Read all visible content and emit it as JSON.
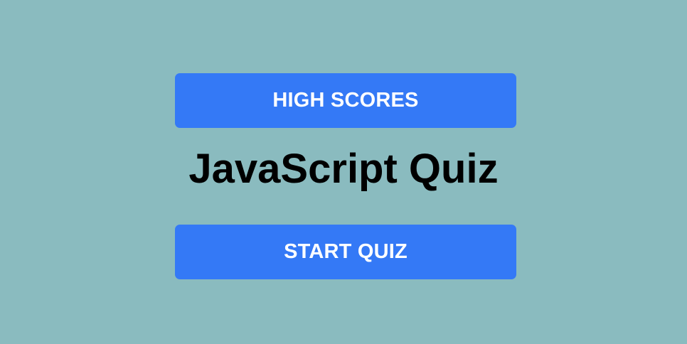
{
  "screen": {
    "background_color": "#8abbbf",
    "accent_color": "#3479f6"
  },
  "menu": {
    "high_scores_label": "HIGH SCORES",
    "title": "JavaScript Quiz",
    "start_label": "START QUIZ"
  }
}
